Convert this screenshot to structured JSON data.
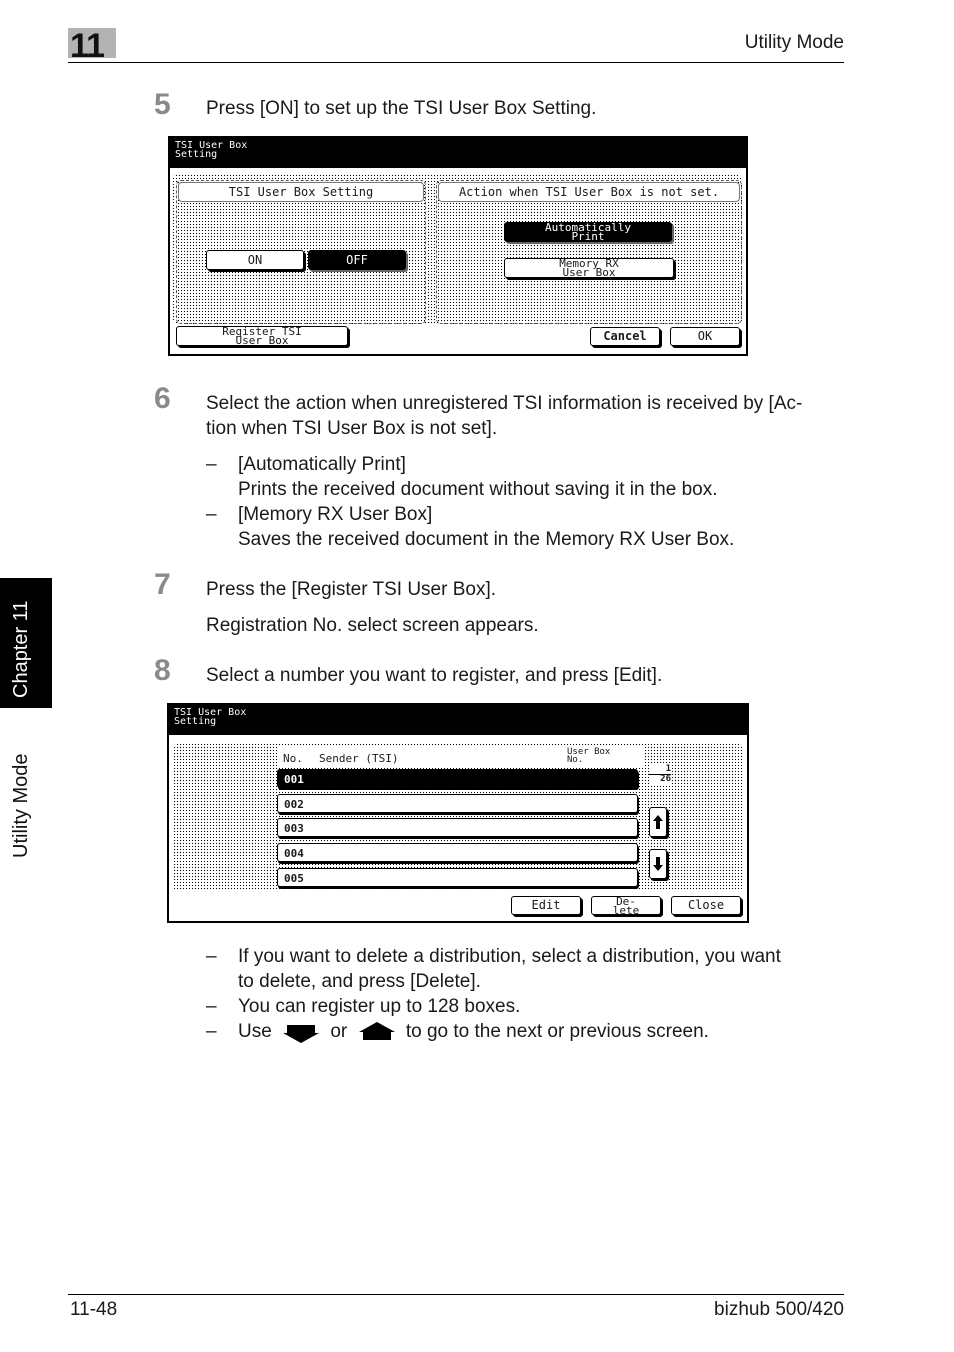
{
  "header": {
    "chapter_number": "11",
    "section_title": "Utility Mode"
  },
  "side_tab": {
    "chapter_label": "Chapter 11",
    "section_label": "Utility Mode"
  },
  "footer": {
    "page_number": "11-48",
    "product": "bizhub 500/420"
  },
  "steps": [
    {
      "number": "5",
      "text": "Press [ON] to set up the TSI User Box Setting."
    },
    {
      "number": "6",
      "text_line1": "Select the action when unregistered TSI information is received by [Ac-",
      "text_line2": "tion when TSI User Box is not set].",
      "bullets": [
        {
          "dash": "–",
          "title": "[Automatically Print]",
          "desc": "Prints the received document without saving it in the box."
        },
        {
          "dash": "–",
          "title": "[Memory RX User Box]",
          "desc": "Saves the received document in the Memory RX User Box."
        }
      ]
    },
    {
      "number": "7",
      "text": "Press the [Register TSI User Box].",
      "subtext": "Registration No. select screen appears."
    },
    {
      "number": "8",
      "text": "Select a number you want to register, and press [Edit].",
      "bullets": [
        {
          "dash": "–",
          "line1": "If you want to delete a distribution, select a distribution, you want",
          "line2": "to delete, and press [Delete]."
        },
        {
          "dash": "–",
          "line1": "You can register up to 128 boxes."
        },
        {
          "dash": "–",
          "use": "Use",
          "or": "or",
          "rest": "to go to the next or previous screen.",
          "icons": [
            "down-arrow-icon",
            "up-arrow-icon"
          ]
        }
      ]
    }
  ],
  "screen1": {
    "title": "TSI User Box\nSetting",
    "left_panel": {
      "heading": "TSI User Box Setting",
      "on_label": "ON",
      "off_label": "OFF",
      "selected": "OFF"
    },
    "right_panel": {
      "heading": "Action when TSI User Box is not set.",
      "auto_print_label": "Automatically\nPrint",
      "memory_rx_label": "Memory RX\nUser Box",
      "selected": "Automatically Print"
    },
    "register_label": "Register TSI\nUser Box",
    "cancel_label": "Cancel",
    "ok_label": "OK"
  },
  "screen2": {
    "title": "TSI User Box\nSetting",
    "columns": {
      "no": "No.",
      "sender": "Sender (TSI)",
      "userbox": "User Box\nNo."
    },
    "rows": [
      {
        "no": "001",
        "selected": true
      },
      {
        "no": "002",
        "selected": false
      },
      {
        "no": "003",
        "selected": false
      },
      {
        "no": "004",
        "selected": false
      },
      {
        "no": "005",
        "selected": false
      }
    ],
    "page_current": "1",
    "page_total": "26",
    "edit_label": "Edit",
    "delete_label": "De-\nlete",
    "close_label": "Close"
  }
}
